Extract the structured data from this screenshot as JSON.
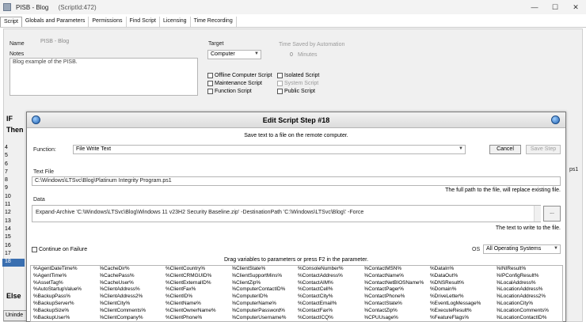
{
  "window": {
    "title": "PISB - Blog",
    "script_id": "(ScriptId:472)"
  },
  "tabs": [
    "Script",
    "Globals and Parameters",
    "Permissions",
    "Find Script",
    "Licensing",
    "Time Recording"
  ],
  "form": {
    "name_label": "Name",
    "name_value": "PISB - Blog",
    "notes_label": "Notes",
    "notes_value": "Blog example of the PISB.",
    "target_label": "Target",
    "target_value": "Computer",
    "time_saved_label": "Time Saved by Automation",
    "time_saved_value": "0",
    "minutes_label": "Minutes",
    "checkboxes": {
      "offline": "Offline Computer Script",
      "maintenance": "Maintenance Script",
      "function": "Function Script",
      "isolated": "Isolated Script",
      "system": "System Script",
      "public": "Public Script"
    }
  },
  "side": {
    "if": "IF",
    "then": "Then",
    "else": "Else",
    "bottom_btn": "Uninde"
  },
  "line_numbers": [
    "4",
    "5",
    "6",
    "7",
    "8",
    "9",
    "10",
    "11",
    "12",
    "13",
    "14",
    "15",
    "16",
    "17",
    "18"
  ],
  "side_suffix": "ps1",
  "dialog": {
    "title": "Edit Script Step #18",
    "subtitle": "Save text to a file on the remote computer.",
    "function_label": "Function:",
    "function_value": "File Write Text",
    "cancel": "Cancel",
    "save": "Save Step",
    "textfile_label": "Text File",
    "textfile_value": "C:\\Windows\\LTSvc\\Blog\\Platinum Integrity Program.ps1",
    "textfile_hint": "The full path to the file, will replace existing file.",
    "data_label": "Data",
    "data_value": "Expand-Archive 'C:\\Windows\\LTSvc\\Blog\\Windows 11 v23H2 Security Baseline.zip' -DestinationPath 'C:\\Windows\\LTSvc\\Blog\\' -Force",
    "data_hint": "The text to write to the file.",
    "ellipsis": "...",
    "continue_on_failure": "Continue on Failure",
    "os_label": "OS",
    "os_value": "All Operating Systems",
    "vars_header": "Drag variables to parameters or press F2 in the parameter.",
    "variables": [
      [
        "%AgentDateTime%",
        "%AgentTime%",
        "%AssetTag%",
        "%AutoStartupValue%",
        "%BackupPass%",
        "%BackupServer%",
        "%BackupSize%",
        "%BackupUser%"
      ],
      [
        "%CacheDir%",
        "%CachePass%",
        "%CacheUser%",
        "%ClientAddress%",
        "%ClientAddress2%",
        "%ClientCity%",
        "%ClientComments%",
        "%ClientCompany%"
      ],
      [
        "%ClientCountry%",
        "%ClientCRMGUID%",
        "%ClientExternalID%",
        "%ClientFax%",
        "%ClientID%",
        "%ClientName%",
        "%ClientOwnerName%",
        "%ClientPhone%"
      ],
      [
        "%ClientState%",
        "%ClientSupportMins%",
        "%ClientZip%",
        "%ComputerContactID%",
        "%ComputerID%",
        "%ComputerName%",
        "%ComputerPassword%",
        "%ComputerUsername%"
      ],
      [
        "%ConsoleNumber%",
        "%ContactAddress%",
        "%ContactAIM%",
        "%ContactCell%",
        "%ContactCity%",
        "%ContactEmail%",
        "%ContactFax%",
        "%ContactICQ%"
      ],
      [
        "%ContactMSN%",
        "%ContactName%",
        "%ContactNetBIOSName%",
        "%ContactPager%",
        "%ContactPhone%",
        "%ContactState%",
        "%ContactZip%",
        "%CPUUsage%"
      ],
      [
        "%DataIn%",
        "%DataOut%",
        "%DNSResult%",
        "%Domain%",
        "%DriveLetter%",
        "%EventLogMessage%",
        "%ExecuteResult%",
        "%FeatureFlags%"
      ],
      [
        "%INIResult%",
        "%IPConfigResult%",
        "%LocalAddress%",
        "%LocationAddress%",
        "%LocationAddress2%",
        "%LocationCity%",
        "%LocationComments%",
        "%LocationContactID%"
      ]
    ]
  }
}
